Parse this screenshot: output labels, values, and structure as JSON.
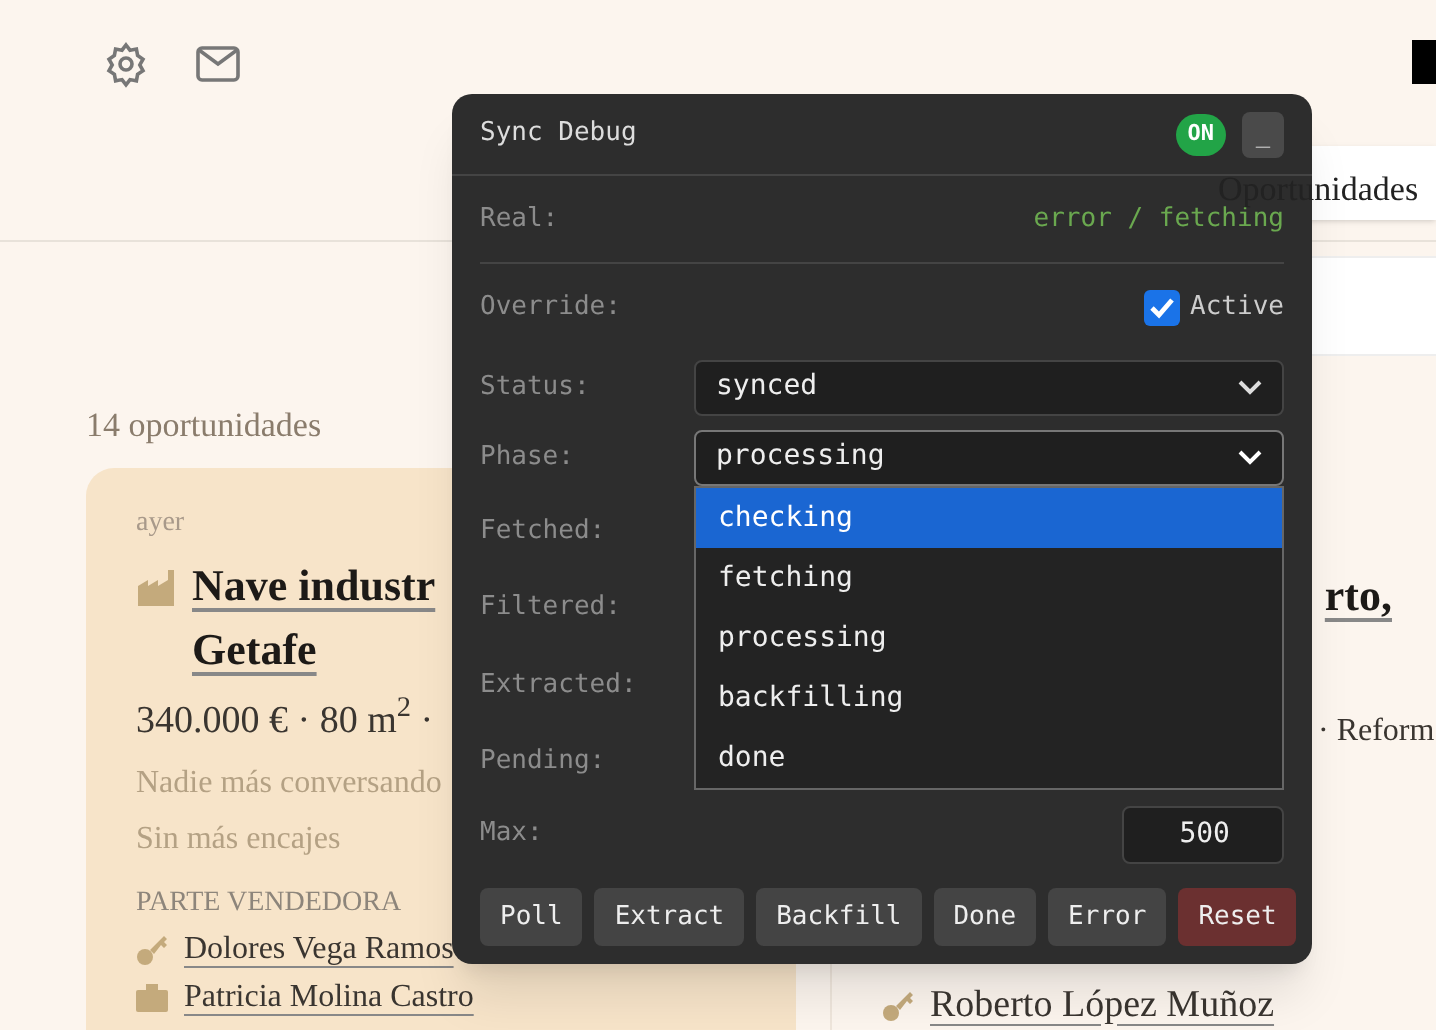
{
  "header": {
    "tab": "Oportunidades"
  },
  "count": "14 oportunidades",
  "cards": [
    {
      "when": "ayer",
      "title": [
        "Nave industr",
        "Getafe"
      ],
      "facts": "340.000 € · 80 m$^{2}$ ·",
      "notes": [
        "Nadie más conversando",
        "Sin más encajes"
      ],
      "section": "PARTE VENDEDORA",
      "people": [
        {
          "kind": "owner",
          "name": "Dolores Vega Ramos"
        },
        {
          "kind": "agent",
          "name": "Patricia Molina Castro"
        }
      ]
    },
    {
      "title": [
        "rto,"
      ],
      "facts": "· Reform",
      "people": [
        {
          "kind": "owner",
          "name": "Roberto López Muñoz"
        }
      ]
    }
  ],
  "debug": {
    "title": "Sync Debug",
    "badge": {
      "label": "ON",
      "on": true
    },
    "minimize": "_",
    "real": {
      "label": "Real:",
      "value": "error / fetching"
    },
    "override": {
      "label": "Override:",
      "checkbox": "Active",
      "checked": true
    },
    "selects": [
      {
        "label": "Status:",
        "value": "synced",
        "expanded": false
      },
      {
        "label": "Phase:",
        "value": "processing",
        "expanded": true
      }
    ],
    "phase_options": [
      {
        "label": "checking",
        "selected": true
      },
      {
        "label": "fetching",
        "selected": false
      },
      {
        "label": "processing",
        "selected": false
      },
      {
        "label": "backfilling",
        "selected": false
      },
      {
        "label": "done",
        "selected": false
      }
    ],
    "counters": [
      "Fetched:",
      "Filtered:",
      "Extracted:",
      "Pending:"
    ],
    "max": {
      "label": "Max:",
      "value": "500"
    },
    "buttons": [
      {
        "label": "Poll",
        "kind": "normal"
      },
      {
        "label": "Extract",
        "kind": "normal"
      },
      {
        "label": "Backfill",
        "kind": "normal"
      },
      {
        "label": "Done",
        "kind": "normal"
      },
      {
        "label": "Error",
        "kind": "normal"
      },
      {
        "label": "Reset",
        "kind": "danger"
      }
    ]
  }
}
